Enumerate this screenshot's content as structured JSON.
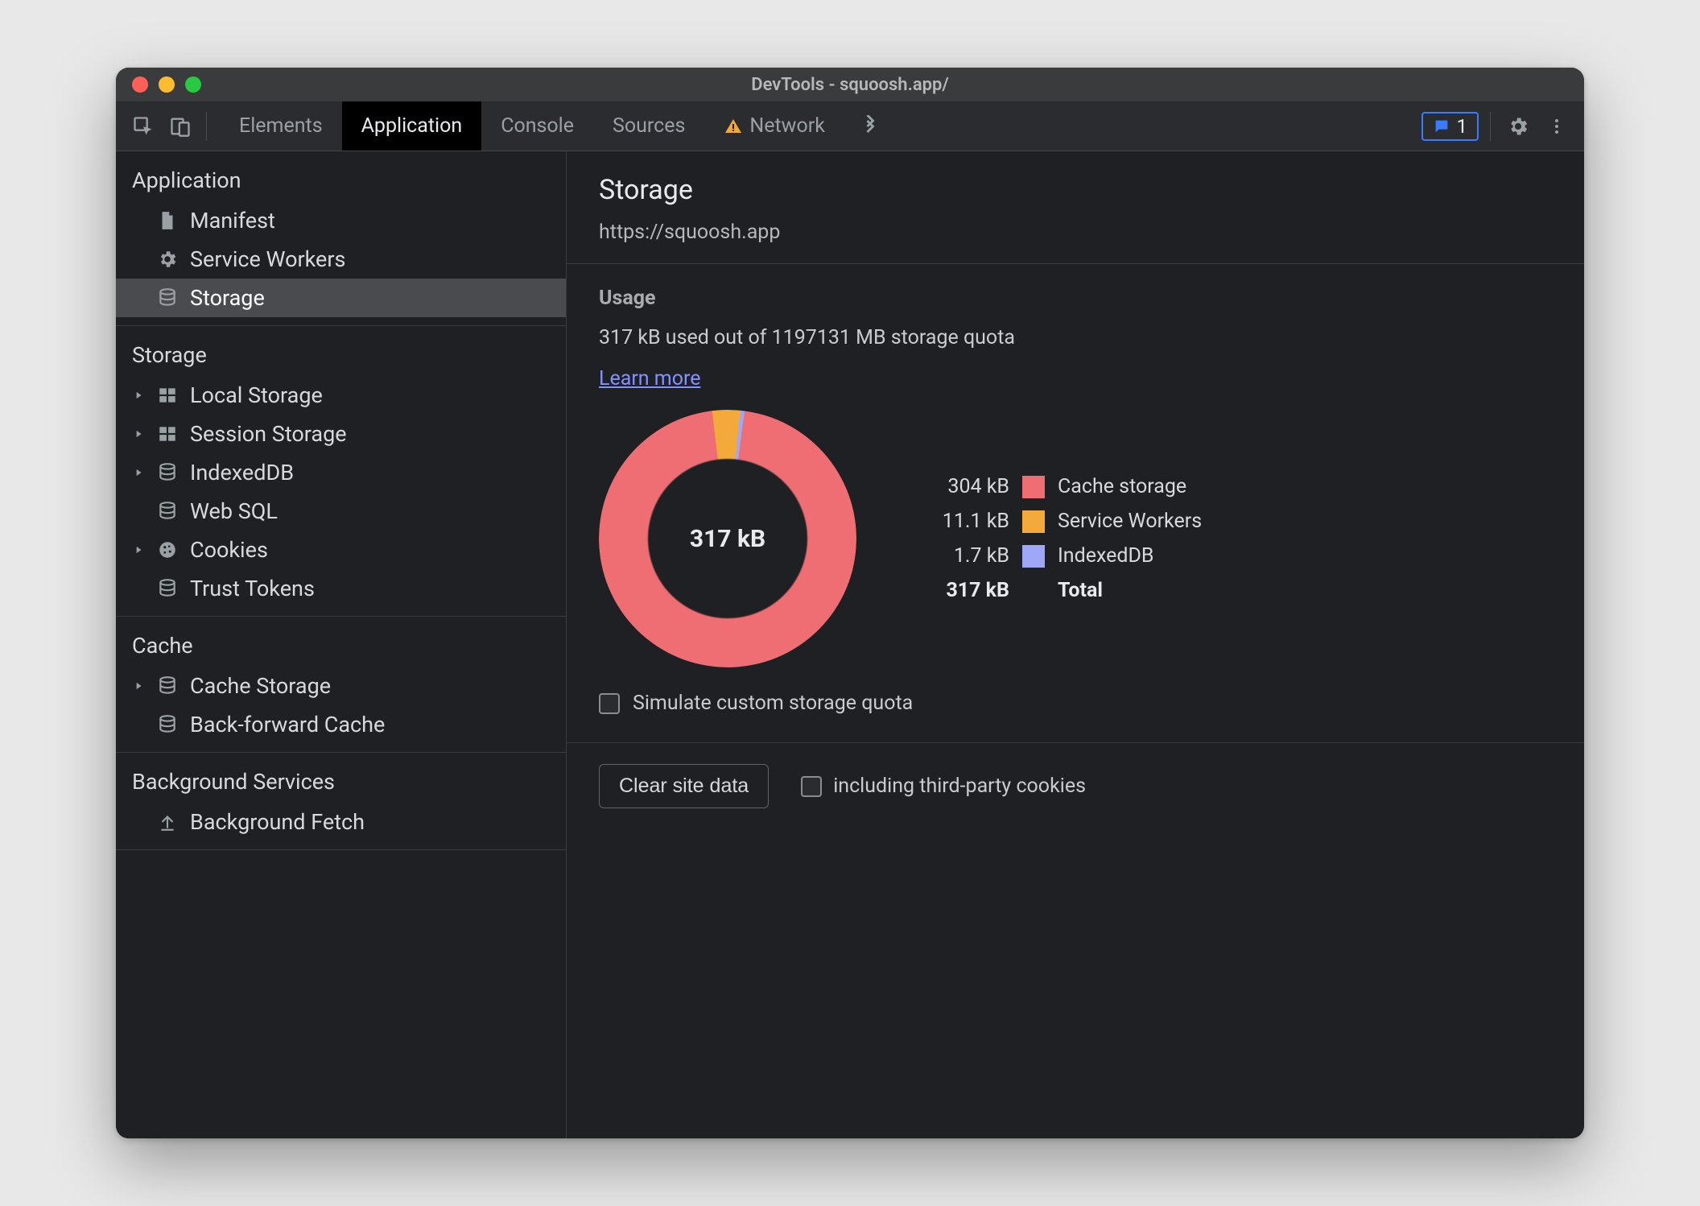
{
  "window": {
    "title": "DevTools - squoosh.app/"
  },
  "tabs": {
    "items": [
      "Elements",
      "Application",
      "Console",
      "Sources",
      "Network"
    ],
    "active": "Application",
    "network_has_warning": true,
    "issues_count": "1"
  },
  "sidebar": {
    "sections": [
      {
        "title": "Application",
        "items": [
          {
            "label": "Manifest",
            "icon": "file",
            "expandable": false,
            "selected": false
          },
          {
            "label": "Service Workers",
            "icon": "gear",
            "expandable": false,
            "selected": false
          },
          {
            "label": "Storage",
            "icon": "db",
            "expandable": false,
            "selected": true
          }
        ]
      },
      {
        "title": "Storage",
        "items": [
          {
            "label": "Local Storage",
            "icon": "grid",
            "expandable": true
          },
          {
            "label": "Session Storage",
            "icon": "grid",
            "expandable": true
          },
          {
            "label": "IndexedDB",
            "icon": "db",
            "expandable": true
          },
          {
            "label": "Web SQL",
            "icon": "db",
            "expandable": false
          },
          {
            "label": "Cookies",
            "icon": "cookie",
            "expandable": true
          },
          {
            "label": "Trust Tokens",
            "icon": "db",
            "expandable": false
          }
        ]
      },
      {
        "title": "Cache",
        "items": [
          {
            "label": "Cache Storage",
            "icon": "db",
            "expandable": true
          },
          {
            "label": "Back-forward Cache",
            "icon": "db",
            "expandable": false
          }
        ]
      },
      {
        "title": "Background Services",
        "items": [
          {
            "label": "Background Fetch",
            "icon": "upload",
            "expandable": false
          }
        ]
      }
    ]
  },
  "main": {
    "title": "Storage",
    "origin": "https://squoosh.app",
    "usage_heading": "Usage",
    "usage_line": "317 kB used out of 1197131 MB storage quota",
    "learn_more": "Learn more",
    "donut_center": "317 kB",
    "legend": [
      {
        "value": "304 kB",
        "label": "Cache storage",
        "color": "#ee6e73"
      },
      {
        "value": "11.1 kB",
        "label": "Service Workers",
        "color": "#f4a93b"
      },
      {
        "value": "1.7 kB",
        "label": "IndexedDB",
        "color": "#9fa8f7"
      }
    ],
    "total_row": {
      "value": "317 kB",
      "label": "Total"
    },
    "simulate_label": "Simulate custom storage quota",
    "clear_button": "Clear site data",
    "third_party_label": "including third-party cookies"
  },
  "colors": {
    "cache": "#ee6e73",
    "sw": "#f4a93b",
    "idb": "#9fa8f7"
  },
  "chart_data": {
    "type": "pie",
    "title": "Storage usage breakdown",
    "unit": "kB",
    "series": [
      {
        "name": "Cache storage",
        "value": 304,
        "color": "#ee6e73"
      },
      {
        "name": "Service Workers",
        "value": 11.1,
        "color": "#f4a93b"
      },
      {
        "name": "IndexedDB",
        "value": 1.7,
        "color": "#9fa8f7"
      }
    ],
    "total": 317,
    "center_label": "317 kB"
  }
}
